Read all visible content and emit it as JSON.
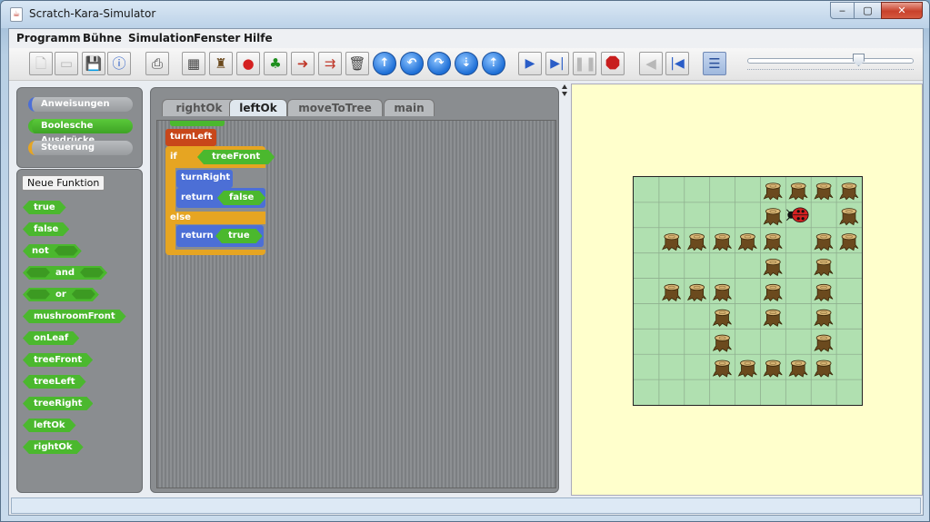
{
  "window": {
    "title": "Scratch-Kara-Simulator",
    "controls": {
      "minimize": "‒",
      "maximize": "▢",
      "close": "✕"
    }
  },
  "menu": [
    "Programm",
    "Bühne",
    "Simulation",
    "Fenster",
    "Hilfe"
  ],
  "categories": [
    {
      "label": "Anweisungen",
      "color": "#4c6fd6"
    },
    {
      "label": "Boolesche Ausdrücke",
      "color": "#4bb82e"
    },
    {
      "label": "Steuerung",
      "color": "#e6a522"
    }
  ],
  "new_function_label": "Neue Funktion",
  "palette": [
    {
      "label": "true",
      "slots": ""
    },
    {
      "label": "false",
      "slots": ""
    },
    {
      "label": "not",
      "slots": "after"
    },
    {
      "label": "and",
      "slots": "both"
    },
    {
      "label": "or",
      "slots": "both"
    },
    {
      "label": "mushroomFront",
      "slots": ""
    },
    {
      "label": "onLeaf",
      "slots": ""
    },
    {
      "label": "treeFront",
      "slots": ""
    },
    {
      "label": "treeLeft",
      "slots": ""
    },
    {
      "label": "treeRight",
      "slots": ""
    },
    {
      "label": "leftOk",
      "slots": ""
    },
    {
      "label": "rightOk",
      "slots": ""
    }
  ],
  "tabs": [
    {
      "label": "rightOk",
      "active": false
    },
    {
      "label": "leftOk",
      "active": true
    },
    {
      "label": "moveToTree",
      "active": false
    },
    {
      "label": "main",
      "active": false
    }
  ],
  "script": {
    "header": "turnLeft",
    "if_label": "if",
    "condition": "treeFront",
    "then": [
      {
        "cmd": "turnRight"
      },
      {
        "cmd": "return",
        "value": "false"
      }
    ],
    "else_label": "else",
    "else": [
      {
        "cmd": "return",
        "value": "true"
      }
    ]
  },
  "world": {
    "cols": 9,
    "rows": 9,
    "trees": [
      [
        5,
        0
      ],
      [
        6,
        0
      ],
      [
        7,
        0
      ],
      [
        8,
        0
      ],
      [
        5,
        1
      ],
      [
        8,
        1
      ],
      [
        1,
        2
      ],
      [
        2,
        2
      ],
      [
        3,
        2
      ],
      [
        4,
        2
      ],
      [
        5,
        2
      ],
      [
        7,
        2
      ],
      [
        8,
        2
      ],
      [
        5,
        3
      ],
      [
        7,
        3
      ],
      [
        1,
        4
      ],
      [
        2,
        4
      ],
      [
        3,
        4
      ],
      [
        5,
        4
      ],
      [
        7,
        4
      ],
      [
        3,
        5
      ],
      [
        5,
        5
      ],
      [
        7,
        5
      ],
      [
        3,
        6
      ],
      [
        7,
        6
      ],
      [
        3,
        7
      ],
      [
        4,
        7
      ],
      [
        5,
        7
      ],
      [
        6,
        7
      ],
      [
        7,
        7
      ]
    ],
    "kara": {
      "col": 6,
      "row": 1,
      "facing": "west"
    }
  },
  "colors": {
    "grass": "#b0e0b0",
    "stage": "#ffffcc",
    "ladybug": "#d42020"
  }
}
